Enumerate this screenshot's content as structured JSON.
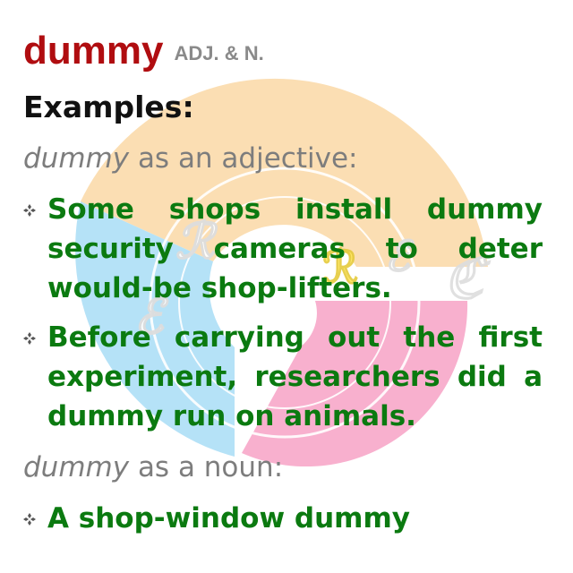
{
  "entry": {
    "headword": "dummy",
    "part_of_speech": "ADJ. & N."
  },
  "examples_label": "Examples:",
  "sections": [
    {
      "term": "dummy",
      "label": "as an adjective:",
      "examples": [
        "Some shops install dummy security cameras to deter would-be shop-lifters.",
        "Before carrying out the first experiment, researchers did a dummy run on animals."
      ]
    },
    {
      "term": "dummy",
      "label": "as a noun:",
      "examples": [
        "A shop-window dummy"
      ]
    }
  ],
  "colors": {
    "headword": "#b00d10",
    "pos": "#8a8a8a",
    "examples_label": "#111111",
    "section_label": "#7d7d7d",
    "example_text": "#0b7a10",
    "watermark_orange": "#fbd9a6",
    "watermark_blue": "#a9ddf6",
    "watermark_pink": "#f7a3c6"
  },
  "icons": {
    "bullet": "four-diamond-bullet-icon",
    "watermark": "circular-logo-watermark"
  }
}
